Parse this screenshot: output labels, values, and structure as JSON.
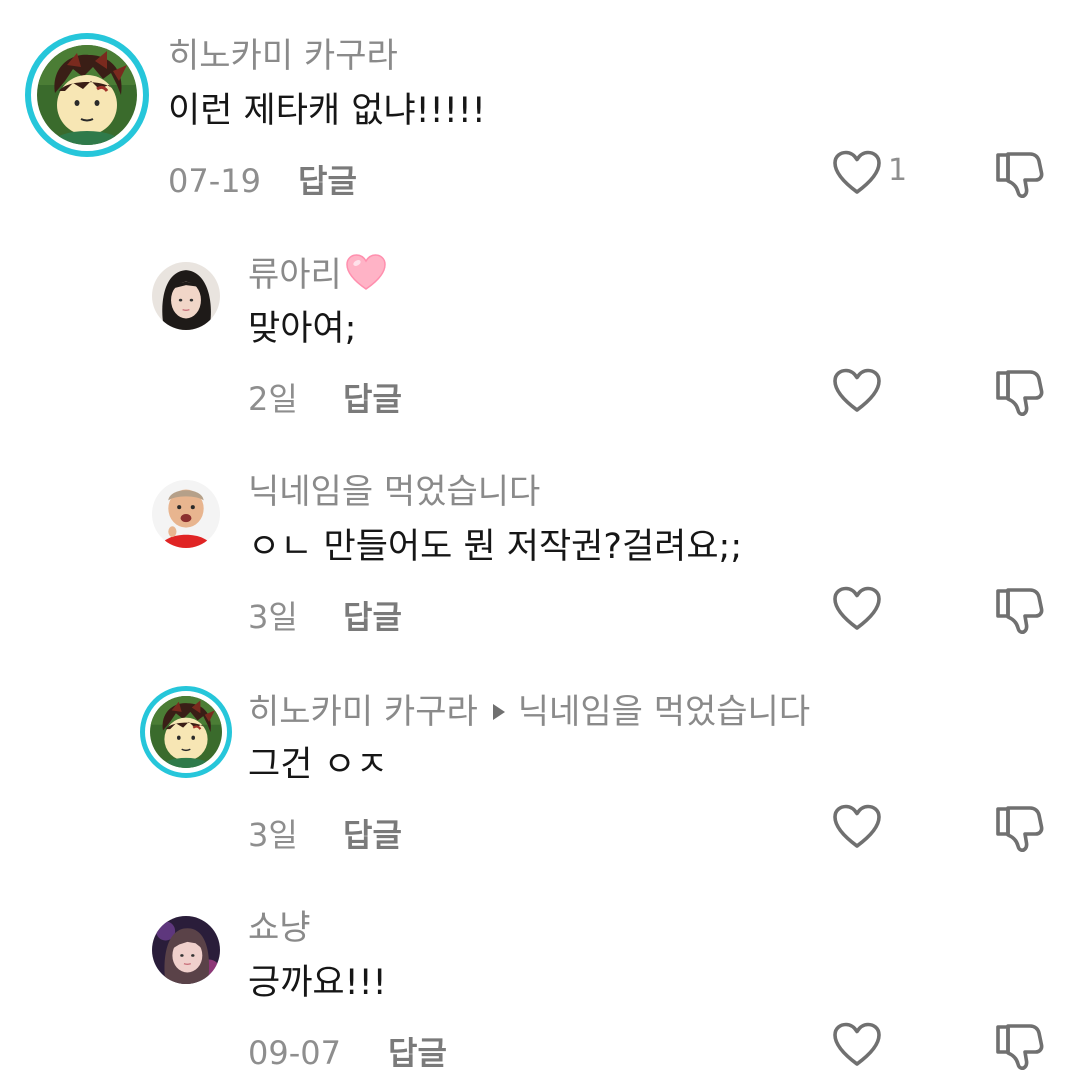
{
  "comments": [
    {
      "author": "히노카미 카구라",
      "text": "이런 제타캐 없냐!!!!!",
      "date": "07-19",
      "reply_label": "답글",
      "likes": "1",
      "avatar_icon": "anime-boy-avatar",
      "ring_color": "#26c6da"
    },
    {
      "author": "류아리",
      "text": "맞아여;",
      "date": "2일",
      "reply_label": "답글",
      "avatar_icon": "girl-photo-avatar"
    },
    {
      "author": "닉네임을 먹었습니다",
      "text": "ㅇㄴ 만들어도 뭔 저작권?걸려요;;",
      "date": "3일",
      "reply_label": "답글",
      "avatar_icon": "child-photo-avatar"
    },
    {
      "author": "히노카미 카구라",
      "reply_to": "닉네임을 먹었습니다",
      "text": "그건 ㅇㅈ",
      "date": "3일",
      "reply_label": "답글",
      "avatar_icon": "anime-boy-avatar",
      "ring_color": "#26c6da"
    },
    {
      "author": "쇼냥",
      "text": "긍까요!!!",
      "date": "09-07",
      "reply_label": "답글",
      "avatar_icon": "girl-photo-avatar"
    }
  ],
  "icons": {
    "like": "heart-outline-icon",
    "dislike": "thumbs-down-outline-icon",
    "reply_arrow": "triangle-right-icon",
    "name_heart": "pink-heart-emoji"
  },
  "colors": {
    "secondary_text": "#8a8a8a",
    "icon_gray": "#707070",
    "avatar_ring": "#26c6da",
    "emoji_heart": "#ff9fb8"
  }
}
